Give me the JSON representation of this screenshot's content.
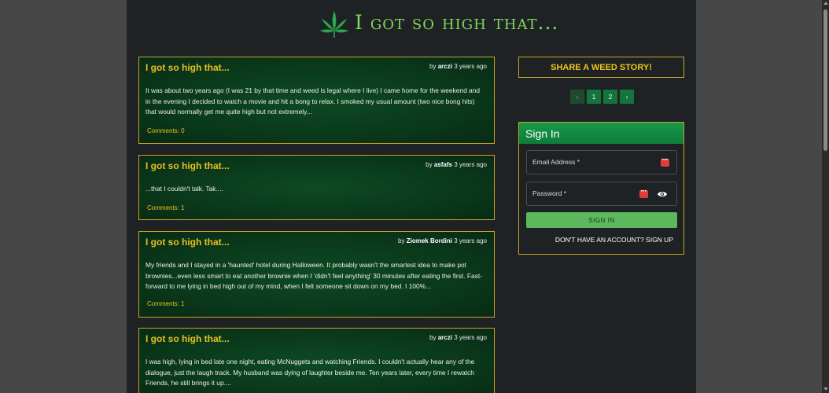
{
  "header": {
    "title": "I got so high that...",
    "logo_icon": "cannabis-leaf-icon"
  },
  "stories": [
    {
      "title": "I got so high that...",
      "by": "by",
      "author": "arczi",
      "time": "3 years ago",
      "body": "It was about two years ago (I was 21 by that time and weed is legal where I live) I came home for the weekend and in the evening I decided to watch a movie and hit a bong to relax. I smoked my usual amount (two nice bong hits) that would normally get me quite high but not extremely...",
      "comments": "Comments: 0"
    },
    {
      "title": "I got so high that...",
      "by": "by",
      "author": "asfafs",
      "time": "3 years ago",
      "body": "...that I couldn't talk. Tak....",
      "comments": "Comments: 1"
    },
    {
      "title": "I got so high that...",
      "by": "by",
      "author": "Ziomek Bordini",
      "time": "3 years ago",
      "body": "My friends and I stayed in a 'haunted' hotel during Halloween. It probably wasn't the smartest idea to make pot brownies...even less smart to eat another brownie when I 'didn't feel anything' 30 minutes after eating the first. Fast-forward to me lying in bed high out of my mind, when I felt someone sit down on my bed. I 100%...",
      "comments": "Comments: 1"
    },
    {
      "title": "I got so high that...",
      "by": "by",
      "author": "arczi",
      "time": "3 years ago",
      "body": "I was high, lying in bed late one night, eating McNuggets and watching Friends. I couldn't actually hear any of the dialogue, just the laugh track. My husband was dying of laughter beside me. Ten years later, every time I rewatch Friends, he still brings it up....",
      "comments": ""
    }
  ],
  "sidebar": {
    "share_label": "SHARE A WEED STORY!",
    "pagination": {
      "prev": "‹",
      "pages": [
        "1",
        "2"
      ],
      "next": "›"
    },
    "signin": {
      "heading": "Sign In",
      "email_label": "Email Address *",
      "password_label": "Password *",
      "button": "SIGN IN",
      "signup": "DON'T HAVE AN ACCOUNT? SIGN UP"
    }
  },
  "colors": {
    "accent": "#e8c020",
    "brand_green": "#13753c",
    "border_gold": "#c9a227"
  }
}
